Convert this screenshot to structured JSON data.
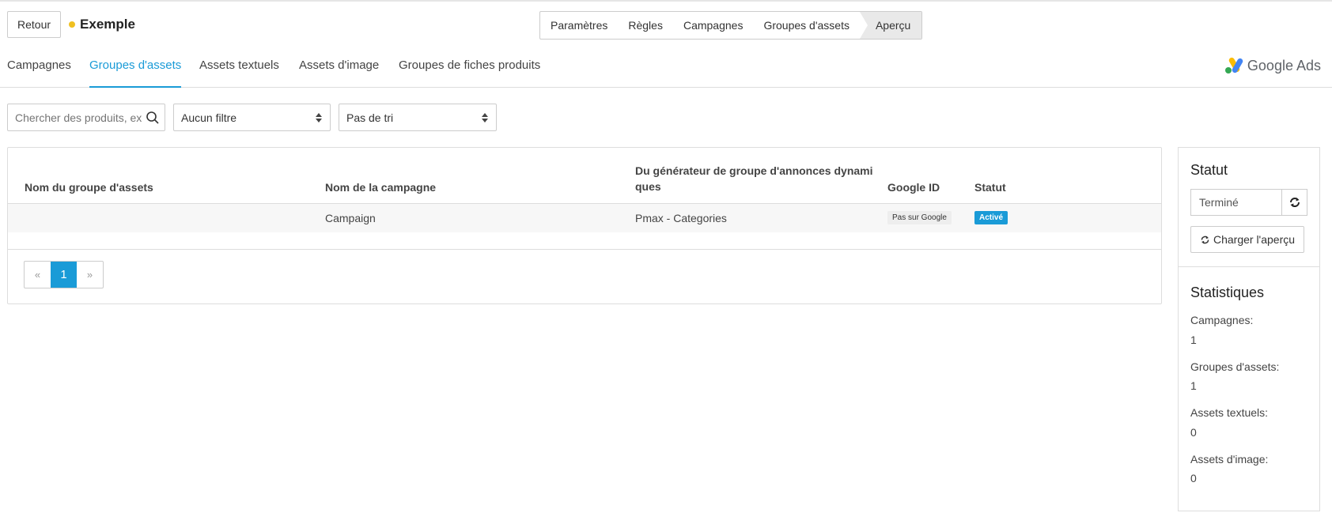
{
  "header": {
    "back_label": "Retour",
    "project_name": "Exemple",
    "status_dot_color": "#f0c020"
  },
  "steps": [
    "Paramètres",
    "Règles",
    "Campagnes",
    "Groupes d'assets",
    "Aperçu"
  ],
  "tabs": [
    "Campagnes",
    "Groupes d'assets",
    "Assets textuels",
    "Assets d'image",
    "Groupes de fiches produits"
  ],
  "brand": {
    "name": "Google Ads"
  },
  "toolbar": {
    "search_placeholder": "Chercher des produits, ex",
    "filter_value": "Aucun filtre",
    "sort_value": "Pas de tri"
  },
  "table": {
    "headers": {
      "name": "Nom du groupe d'assets",
      "campaign": "Nom de la campagne",
      "generator_line1": "Du générateur de groupe d'annonces dynami",
      "generator_line2": "ques",
      "google_id": "Google ID",
      "status": "Statut"
    },
    "rows": [
      {
        "name": "",
        "campaign": "Campaign",
        "generator": "Pmax - Categories",
        "google_id": "Pas sur Google",
        "status": "Activé"
      }
    ]
  },
  "pagination": {
    "prev": "«",
    "current": "1",
    "next": "»"
  },
  "sidebar": {
    "status_title": "Statut",
    "status_value": "Terminé",
    "load_label": "Charger l'aperçu",
    "stats_title": "Statistiques",
    "stats": [
      {
        "label": "Campagnes:",
        "value": "1"
      },
      {
        "label": "Groupes d'assets:",
        "value": "1"
      },
      {
        "label": "Assets textuels:",
        "value": "0"
      },
      {
        "label": "Assets d'image:",
        "value": "0"
      }
    ]
  },
  "colors": {
    "accent": "#1a9bd7"
  }
}
